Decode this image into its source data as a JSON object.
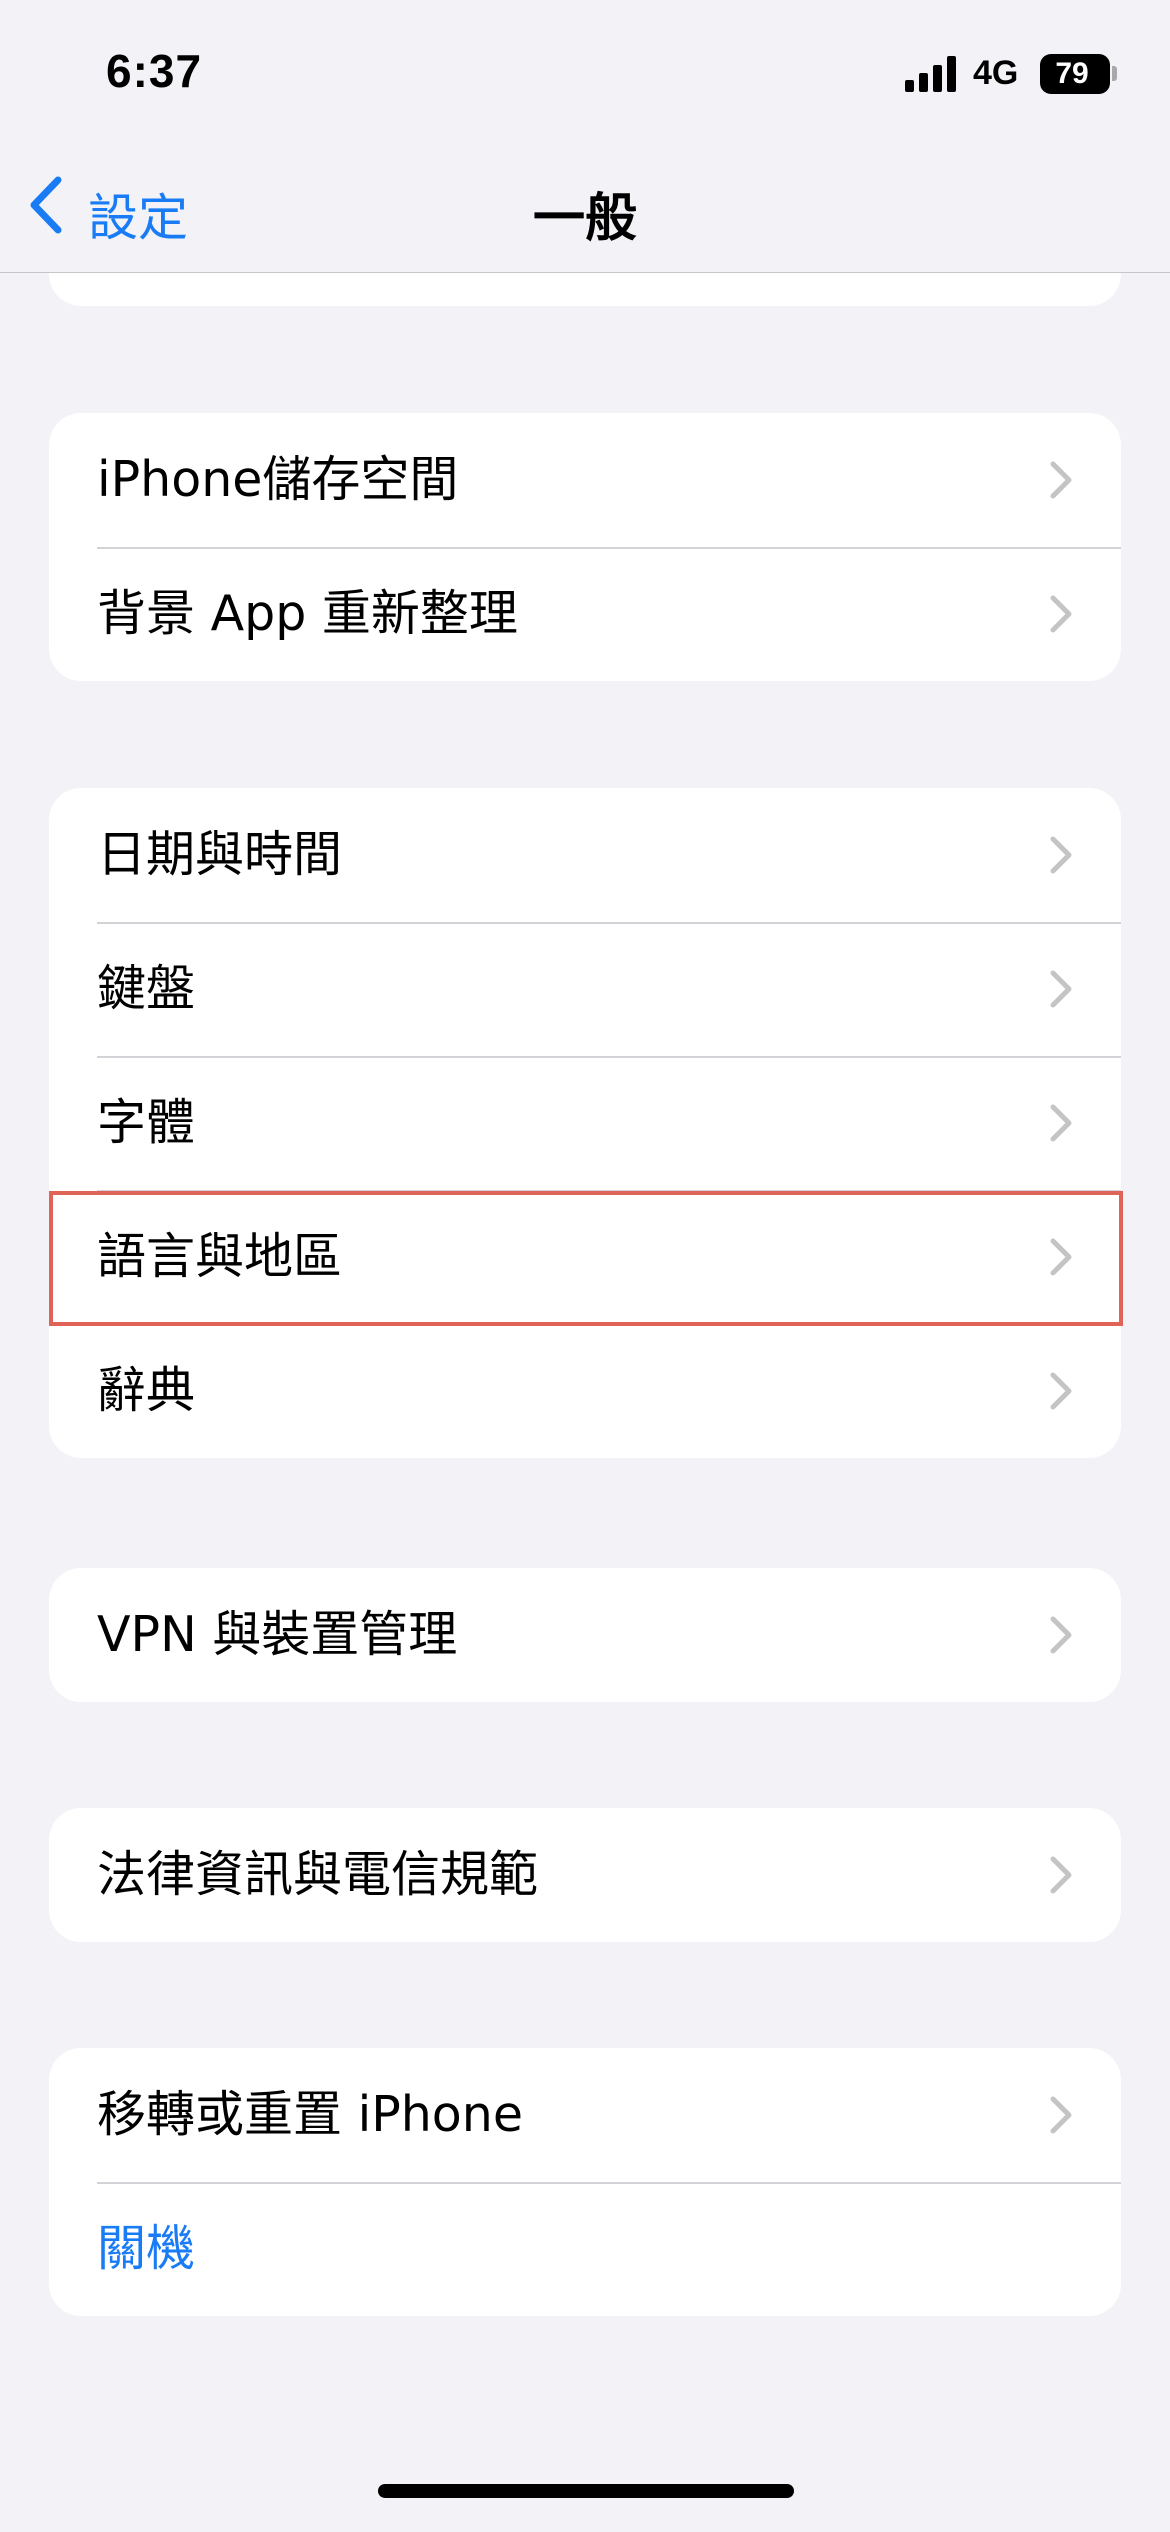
{
  "status_bar": {
    "time": "6:37",
    "network": "4G",
    "battery": "79"
  },
  "nav": {
    "back_label": "設定",
    "title": "一般"
  },
  "groups": [
    {
      "rows": [
        {
          "label": "iPhone儲存空間"
        },
        {
          "label": "背景 App 重新整理"
        }
      ]
    },
    {
      "rows": [
        {
          "label": "日期與時間"
        },
        {
          "label": "鍵盤"
        },
        {
          "label": "字體"
        },
        {
          "label": "語言與地區",
          "highlighted": true
        },
        {
          "label": "辭典"
        }
      ]
    },
    {
      "rows": [
        {
          "label": "VPN 與裝置管理"
        }
      ]
    },
    {
      "rows": [
        {
          "label": "法律資訊與電信規範"
        }
      ]
    },
    {
      "rows": [
        {
          "label": "移轉或重置 iPhone"
        },
        {
          "label": "關機",
          "style": "action"
        }
      ]
    }
  ],
  "colors": {
    "accent": "#1a7cf5",
    "highlight_border": "#e06358",
    "background": "#f2f2f7"
  }
}
